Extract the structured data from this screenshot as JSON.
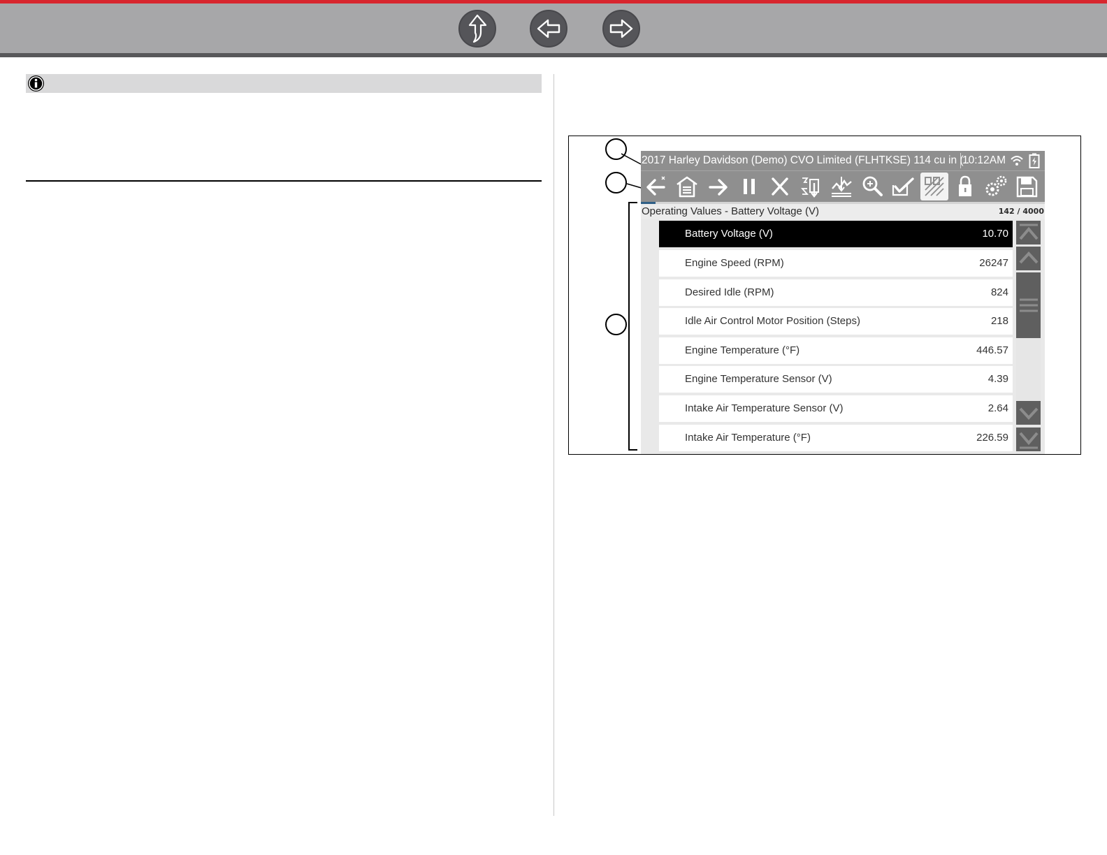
{
  "nav": {
    "buttons": [
      {
        "name": "up-arrow-icon"
      },
      {
        "name": "back-arrow-icon"
      },
      {
        "name": "forward-arrow-icon"
      }
    ]
  },
  "info_banner": {
    "icon": "info-icon"
  },
  "device": {
    "title_bar": {
      "vehicle": "2017 Harley Davidson (Demo) CVO Limited (FLHTKSE) 114 cu in (..",
      "time": "10:12AM",
      "icons": [
        "wifi-icon",
        "battery-charging-icon"
      ]
    },
    "toolbar_icons": [
      "back-icon",
      "home-icon",
      "forward-icon",
      "pause-icon",
      "exit-icon",
      "sort-icon",
      "graph-view-icon",
      "zoom-icon",
      "select-icon",
      "list-view-icon",
      "lock-icon",
      "settings-icon",
      "save-icon"
    ],
    "selected_toolbar_icon": "list-view-icon",
    "progress_fraction": 0.0355,
    "list_header": {
      "title": "Operating Values - Battery Voltage (V)",
      "count": "142 / 4000"
    },
    "rows": [
      {
        "label": "Battery Voltage (V)",
        "value": "10.70",
        "selected": true
      },
      {
        "label": "Engine Speed (RPM)",
        "value": "26247"
      },
      {
        "label": "Desired Idle (RPM)",
        "value": "824"
      },
      {
        "label": "Idle Air Control Motor Position (Steps)",
        "value": "218"
      },
      {
        "label": "Engine Temperature (°F)",
        "value": "446.57"
      },
      {
        "label": "Engine Temperature Sensor (V)",
        "value": "4.39"
      },
      {
        "label": "Intake Air Temperature Sensor (V)",
        "value": "2.64"
      },
      {
        "label": "Intake Air Temperature (°F)",
        "value": "226.59"
      }
    ],
    "scrollbar_icons": [
      "scroll-top-icon",
      "scroll-up-icon",
      "scroll-thumb-icon",
      "scroll-down-icon",
      "scroll-bottom-icon"
    ]
  },
  "colors": {
    "accent_red": "#d8262e",
    "nav_gray": "#a7a7a9",
    "device_bar": "#8f8f8f",
    "selected_row": "#000000"
  }
}
